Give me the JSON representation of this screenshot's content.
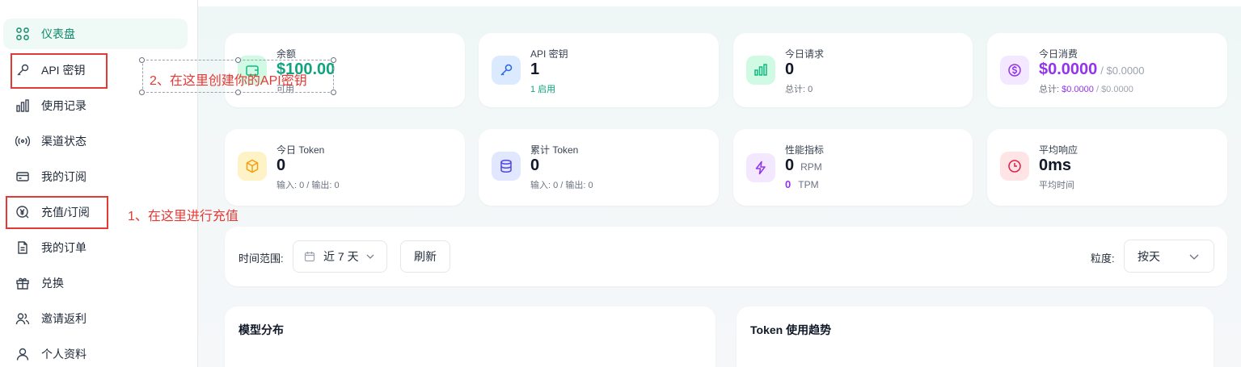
{
  "sidebar": {
    "items": [
      {
        "label": "仪表盘",
        "icon": "dashboard-grid-icon"
      },
      {
        "label": "API 密钥",
        "icon": "key-icon"
      },
      {
        "label": "使用记录",
        "icon": "bar-chart-icon"
      },
      {
        "label": "渠道状态",
        "icon": "broadcast-icon"
      },
      {
        "label": "我的订阅",
        "icon": "credit-card-icon"
      },
      {
        "label": "充值/订阅",
        "icon": "yen-coin-icon"
      },
      {
        "label": "我的订单",
        "icon": "document-icon"
      },
      {
        "label": "兑换",
        "icon": "gift-icon"
      },
      {
        "label": "邀请返利",
        "icon": "users-icon"
      },
      {
        "label": "个人资料",
        "icon": "user-icon"
      }
    ]
  },
  "stats": {
    "balance": {
      "label": "余额",
      "value": "$100.00",
      "sub": "可用"
    },
    "api_keys": {
      "label": "API 密钥",
      "value": "1",
      "sub": "1 启用"
    },
    "today_requests": {
      "label": "今日请求",
      "value": "0",
      "sub": "总计: 0"
    },
    "today_cost": {
      "label": "今日消费",
      "value": "$0.0000",
      "value_suffix": "/ $0.0000",
      "sub_prefix": "总计:",
      "sub_value": "$0.0000",
      "sub_suffix": "/ $0.0000"
    },
    "today_token": {
      "label": "今日 Token",
      "value": "0",
      "sub": "输入: 0 / 输出: 0"
    },
    "total_token": {
      "label": "累计 Token",
      "value": "0",
      "sub": "输入: 0 / 输出: 0"
    },
    "performance": {
      "label": "性能指标",
      "rpm_value": "0",
      "rpm_unit": "RPM",
      "tpm_value": "0",
      "tpm_unit": "TPM"
    },
    "avg_response": {
      "label": "平均响应",
      "value": "0ms",
      "sub": "平均时间"
    }
  },
  "filters": {
    "time_range_label": "时间范围:",
    "time_range_value": "近 7 天",
    "refresh_label": "刷新",
    "granularity_label": "粒度:",
    "granularity_value": "按天"
  },
  "sections": {
    "model_distribution": "模型分布",
    "token_trend": "Token 使用趋势"
  },
  "annotations": {
    "step1": "1、在这里进行充值",
    "step2": "2、在这里创建你的API密钥"
  },
  "colors": {
    "accent": "#0f8a6a",
    "annotation_red": "#e53935",
    "purple": "#9333ea"
  }
}
